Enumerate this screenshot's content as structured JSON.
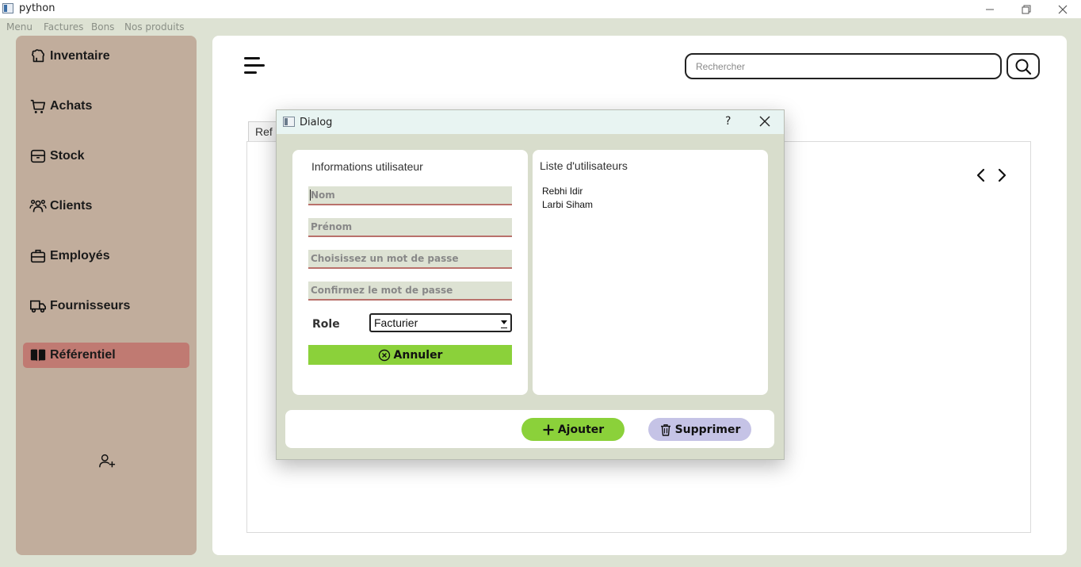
{
  "window": {
    "title": "python",
    "minimize_icon": "minimize-icon",
    "maximize_icon": "restore-icon",
    "close_icon": "close-icon"
  },
  "menubar": {
    "items": [
      "Menu",
      "Factures",
      "Bons",
      "Nos produits"
    ]
  },
  "sidebar": {
    "background": "#c1ad9c",
    "active_color": "#c07a72",
    "items": [
      {
        "label": "Inventaire",
        "icon": "inventory-icon"
      },
      {
        "label": "Achats",
        "icon": "cart-icon"
      },
      {
        "label": "Stock",
        "icon": "stock-icon"
      },
      {
        "label": "Clients",
        "icon": "clients-icon"
      },
      {
        "label": "Employés",
        "icon": "briefcase-icon"
      },
      {
        "label": "Fournisseurs",
        "icon": "truck-icon"
      },
      {
        "label": "Référentiel",
        "icon": "book-icon",
        "active": true
      }
    ],
    "add_user_icon": "add-user-icon"
  },
  "main": {
    "search_placeholder": "Rechercher",
    "tab_label": "Ref"
  },
  "dialog": {
    "title": "Dialog",
    "help": "?",
    "user_info": {
      "title": "Informations utilisateur",
      "nom_placeholder": "Nom",
      "prenom_placeholder": "Prénom",
      "password_placeholder": "Choisissez un mot de passe",
      "confirm_placeholder": "Confirmez le mot de passe",
      "role_label": "Role",
      "role_value": "Facturier",
      "annuler_label": "Annuler"
    },
    "user_list": {
      "title": "Liste d'utilisateurs",
      "users": [
        "Rebhi Idir",
        "Larbi Siham"
      ]
    },
    "buttons": {
      "ajouter_label": "Ajouter",
      "supprimer_label": "Supprimer",
      "ajouter_color": "#8bd13a",
      "supprimer_color": "#c5c3e6"
    }
  }
}
